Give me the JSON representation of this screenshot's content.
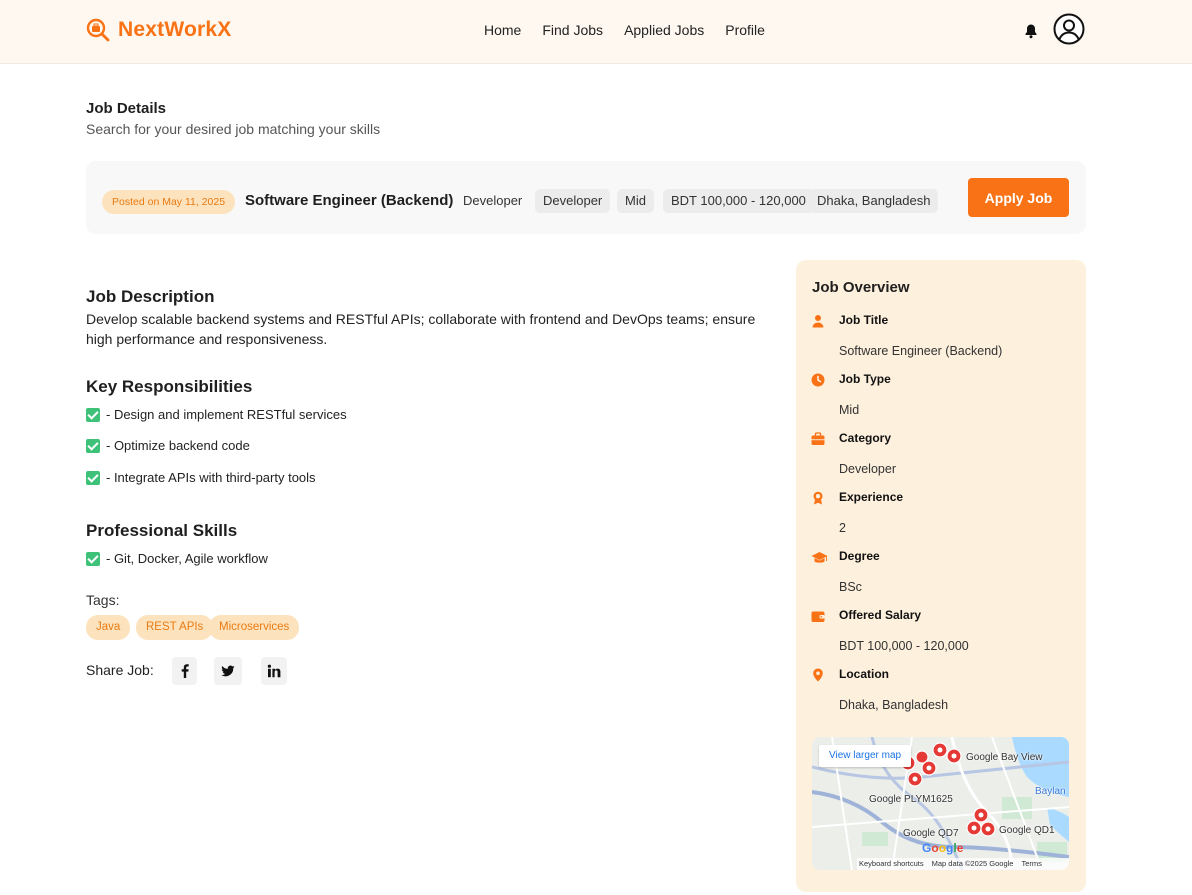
{
  "brand": {
    "name": "NextWorkX",
    "color": "#f97316"
  },
  "nav": {
    "items": [
      "Home",
      "Find Jobs",
      "Applied Jobs",
      "Profile"
    ]
  },
  "header_icons": [
    "bell-icon",
    "user-avatar-icon"
  ],
  "page": {
    "title": "Job Details",
    "subtitle": "Search for your desired job matching your skills"
  },
  "job": {
    "posted": "Posted on May 11, 2025",
    "title": "Software Engineer (Backend)",
    "category": "Developer",
    "chips": [
      "Developer",
      "Mid",
      "BDT 100,000 - 120,000",
      "Dhaka, Bangladesh"
    ],
    "apply_label": "Apply Job"
  },
  "description": {
    "heading": "Job Description",
    "text": "Develop scalable backend systems and RESTful APIs; collaborate with frontend and DevOps teams; ensure high performance and responsiveness."
  },
  "responsibilities": {
    "heading": "Key Responsibilities",
    "items": [
      "- Design and implement RESTful services",
      "- Optimize backend code",
      "- Integrate APIs with third-party tools"
    ]
  },
  "skills": {
    "heading": "Professional Skills",
    "items": [
      "- Git, Docker, Agile workflow"
    ]
  },
  "tags": {
    "label": "Tags:",
    "items": [
      "Java",
      "REST APIs",
      "Microservices"
    ]
  },
  "share": {
    "label": "Share Job:",
    "icons": [
      "facebook-icon",
      "twitter-icon",
      "linkedin-icon"
    ]
  },
  "overview": {
    "title": "Job Overview",
    "rows": [
      {
        "label": "Job Title",
        "value": "Software Engineer (Backend)",
        "icon": "user-icon"
      },
      {
        "label": "Job Type",
        "value": "Mid",
        "icon": "clock-icon"
      },
      {
        "label": "Category",
        "value": "Developer",
        "icon": "briefcase-icon"
      },
      {
        "label": "Experience",
        "value": "2",
        "icon": "award-icon"
      },
      {
        "label": "Degree",
        "value": "BSc",
        "icon": "graduation-cap-icon"
      },
      {
        "label": "Offered Salary",
        "value": "BDT 100,000 - 120,000",
        "icon": "wallet-icon"
      },
      {
        "label": "Location",
        "value": "Dhaka, Bangladesh",
        "icon": "location-pin-icon"
      }
    ],
    "icon_color": "#f97316"
  },
  "map": {
    "button": "View larger map",
    "labels": [
      "Google Bay View",
      "Google PLYM1625",
      "Google QD7",
      "Google QD1",
      "Baylan"
    ],
    "footer": [
      "Keyboard shortcuts",
      "Map data ©2025 Google",
      "Terms"
    ],
    "logo": "Google"
  }
}
